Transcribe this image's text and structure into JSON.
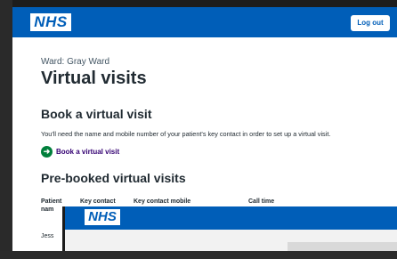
{
  "header": {
    "logo_text": "NHS",
    "logout_label": "Log out"
  },
  "page": {
    "ward": "Ward: Gray Ward",
    "title": "Virtual visits"
  },
  "book": {
    "heading": "Book a virtual visit",
    "description": "You'll need the name and mobile number of your patient's key contact in order to set up a virtual visit.",
    "link_label": "Book a virtual visit"
  },
  "prebooked": {
    "heading": "Pre-booked virtual visits",
    "columns": [
      "Patient nam",
      "Key contact",
      "Key contact mobile",
      "Call time"
    ],
    "rows": [
      [
        "Jess"
      ]
    ]
  },
  "overlay_window": {
    "logo_text": "NHS"
  },
  "colors": {
    "nhs_blue": "#005eb8",
    "link_purple": "#330072",
    "go_green": "#007f3b"
  }
}
